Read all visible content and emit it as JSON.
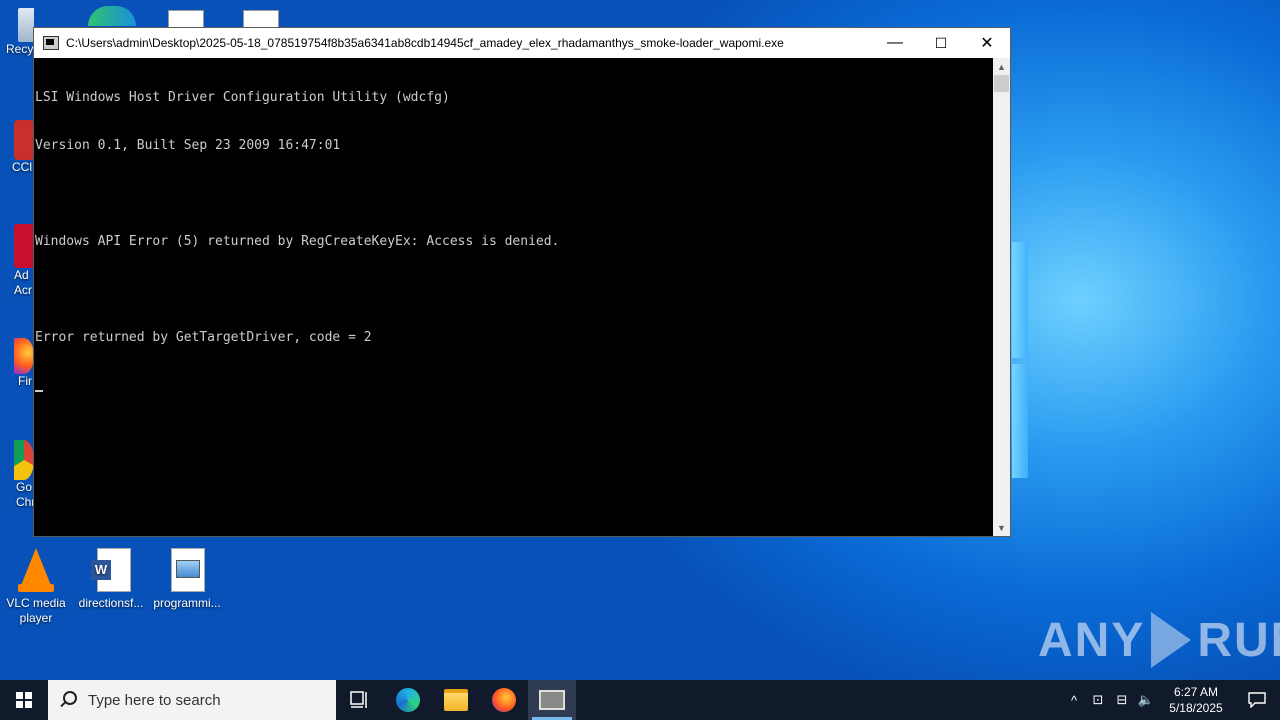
{
  "window": {
    "title": "C:\\Users\\admin\\Desktop\\2025-05-18_078519754f8b35a6341ab8cdb14945cf_amadey_elex_rhadamanthys_smoke-loader_wapomi.exe",
    "minimize_glyph": "—",
    "maximize_glyph": "☐",
    "close_glyph": "✕"
  },
  "console": {
    "lines": [
      "LSI Windows Host Driver Configuration Utility (wdcfg)",
      "Version 0.1, Built Sep 23 2009 16:47:01",
      "",
      "Windows API Error (5) returned by RegCreateKeyEx: Access is denied.",
      "",
      "Error returned by GetTargetDriver, code = 2"
    ]
  },
  "desktop": {
    "icons": [
      {
        "label": "VLC media player",
        "icon": "vlc-icon"
      },
      {
        "label": "directionsf...",
        "icon": "word-document-icon"
      },
      {
        "label": "programmi...",
        "icon": "image-file-icon"
      }
    ],
    "edge_labels": [
      "Recy",
      "CCl",
      "Ad Acr",
      "Fir",
      "Go Chr"
    ]
  },
  "taskbar": {
    "search_placeholder": "Type here to search",
    "clock_time": "6:27 AM",
    "clock_date": "5/18/2025"
  },
  "watermark": {
    "left": "ANY",
    "right": "RUN"
  }
}
